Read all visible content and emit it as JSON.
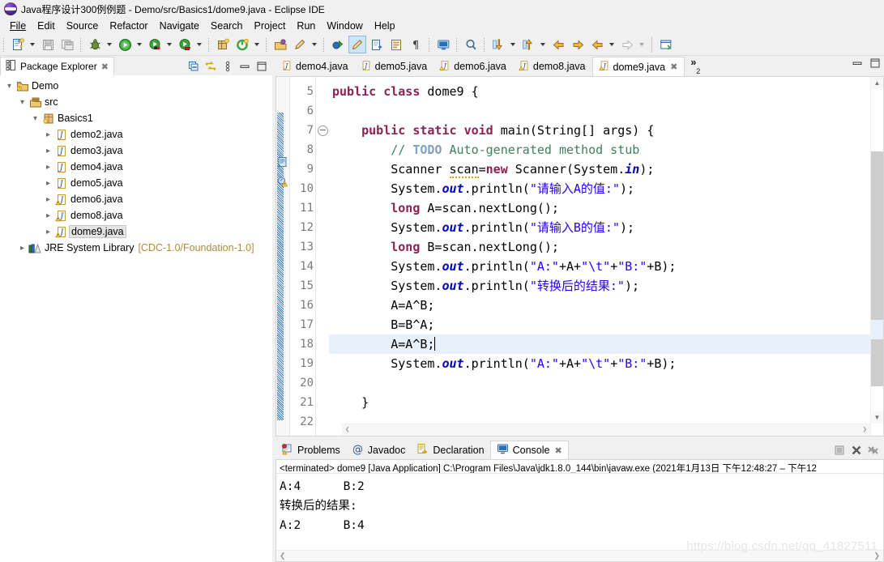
{
  "window": {
    "title": "Java程序设计300例例题 - Demo/src/Basics1/dome9.java - Eclipse IDE",
    "app_icon": "eclipse-icon"
  },
  "menubar": {
    "items": [
      {
        "label": "File"
      },
      {
        "label": "Edit"
      },
      {
        "label": "Source"
      },
      {
        "label": "Refactor"
      },
      {
        "label": "Navigate"
      },
      {
        "label": "Search"
      },
      {
        "label": "Project"
      },
      {
        "label": "Run"
      },
      {
        "label": "Window"
      },
      {
        "label": "Help"
      }
    ]
  },
  "toolbar": {
    "buttons": [
      {
        "name": "new-wizard",
        "icon": "new-file-icon"
      },
      {
        "name": "save",
        "icon": "save-icon"
      },
      {
        "name": "save-all",
        "icon": "save-all-icon"
      },
      {
        "name": "debug",
        "icon": "debug-bug-icon"
      },
      {
        "name": "run",
        "icon": "run-play-icon"
      },
      {
        "name": "coverage",
        "icon": "coverage-icon"
      },
      {
        "name": "run-external",
        "icon": "external-tools-icon"
      },
      {
        "name": "new-java-project",
        "icon": "new-java-project-icon"
      },
      {
        "name": "new-java-class",
        "icon": "new-class-icon"
      },
      {
        "name": "open-type",
        "icon": "open-type-icon"
      },
      {
        "name": "open-task",
        "icon": "task-icon"
      },
      {
        "name": "skip-breakpoints",
        "icon": "skip-breakpoints-icon"
      },
      {
        "name": "toggle-mark-occurrences",
        "icon": "mark-occurrences-icon"
      },
      {
        "name": "link-with-editor",
        "icon": "link-editor-icon"
      },
      {
        "name": "toggle-block-selection",
        "icon": "block-selection-icon"
      },
      {
        "name": "show-whitespace",
        "icon": "pilcrow-icon"
      },
      {
        "name": "toggle-console",
        "icon": "console-icon"
      },
      {
        "name": "search",
        "icon": "search-icon"
      },
      {
        "name": "next-annotation",
        "icon": "next-annotation-icon"
      },
      {
        "name": "previous-annotation",
        "icon": "previous-annotation-icon"
      },
      {
        "name": "back-history",
        "icon": "back-arrow-icon"
      },
      {
        "name": "forward-history",
        "icon": "forward-arrow-icon"
      },
      {
        "name": "previous-edit",
        "icon": "prev-edit-icon"
      },
      {
        "name": "next-edit",
        "icon": "next-edit-icon"
      },
      {
        "name": "new-window",
        "icon": "new-window-icon"
      }
    ]
  },
  "package_explorer": {
    "tab_label": "Package Explorer",
    "tab_icon": "package-explorer-icon",
    "toolbar": [
      {
        "name": "collapse-all",
        "icon": "collapse-all-icon"
      },
      {
        "name": "link-with-editor",
        "icon": "link-with-editor-icon"
      },
      {
        "name": "view-menu",
        "icon": "view-menu-icon"
      },
      {
        "name": "minimize-view",
        "icon": "minimize-icon"
      },
      {
        "name": "maximize-view",
        "icon": "maximize-icon"
      }
    ],
    "tree": [
      {
        "label": "Demo",
        "icon": "java-project-icon",
        "indent": 0,
        "twisty": "down",
        "selected": false,
        "sub": ""
      },
      {
        "label": "src",
        "icon": "source-folder-icon",
        "indent": 1,
        "twisty": "down",
        "selected": false,
        "sub": ""
      },
      {
        "label": "Basics1",
        "icon": "package-icon",
        "indent": 2,
        "twisty": "down",
        "selected": false,
        "sub": ""
      },
      {
        "label": "demo2.java",
        "icon": "java-file-icon",
        "indent": 3,
        "twisty": "right",
        "selected": false,
        "sub": ""
      },
      {
        "label": "demo3.java",
        "icon": "java-file-icon",
        "indent": 3,
        "twisty": "right",
        "selected": false,
        "sub": ""
      },
      {
        "label": "demo4.java",
        "icon": "java-file-icon",
        "indent": 3,
        "twisty": "right",
        "selected": false,
        "sub": ""
      },
      {
        "label": "demo5.java",
        "icon": "java-file-icon",
        "indent": 3,
        "twisty": "right",
        "selected": false,
        "sub": ""
      },
      {
        "label": "demo6.java",
        "icon": "java-file-warning-icon",
        "indent": 3,
        "twisty": "right",
        "selected": false,
        "sub": ""
      },
      {
        "label": "demo8.java",
        "icon": "java-file-warning-icon",
        "indent": 3,
        "twisty": "right",
        "selected": false,
        "sub": ""
      },
      {
        "label": "dome9.java",
        "icon": "java-file-warning-icon",
        "indent": 3,
        "twisty": "right",
        "selected": true,
        "sub": ""
      },
      {
        "label": "JRE System Library",
        "icon": "library-icon",
        "indent": 1,
        "twisty": "right",
        "selected": false,
        "sub": "[CDC-1.0/Foundation-1.0]"
      }
    ]
  },
  "editor": {
    "tabs": [
      {
        "label": "demo4.java",
        "icon": "java-file-icon",
        "active": false,
        "closable": false
      },
      {
        "label": "demo5.java",
        "icon": "java-file-icon",
        "active": false,
        "closable": false
      },
      {
        "label": "demo6.java",
        "icon": "java-file-warning-icon",
        "active": false,
        "closable": false
      },
      {
        "label": "demo8.java",
        "icon": "java-file-warning-icon",
        "active": false,
        "closable": false
      },
      {
        "label": "dome9.java",
        "icon": "java-file-warning-icon",
        "active": true,
        "closable": true
      }
    ],
    "overflow_chevron": "»",
    "overflow_count": "2",
    "toolbar": [
      {
        "name": "minimize-editor",
        "icon": "minimize-icon"
      },
      {
        "name": "maximize-editor",
        "icon": "maximize-icon"
      }
    ],
    "first_line_number": 5,
    "current_line": 18,
    "folded_line": 7,
    "annotations": [
      {
        "line": 8,
        "icon": "todo-task-icon"
      },
      {
        "line": 9,
        "icon": "warning-quickfix-icon"
      }
    ],
    "lines": [
      {
        "n": 5,
        "tokens": [
          {
            "t": "public",
            "c": "k"
          },
          {
            "t": " ",
            "c": "pl"
          },
          {
            "t": "class",
            "c": "k"
          },
          {
            "t": " dome9 {",
            "c": "pl"
          }
        ]
      },
      {
        "n": 6,
        "tokens": []
      },
      {
        "n": 7,
        "tokens": [
          {
            "t": "    ",
            "c": "pl"
          },
          {
            "t": "public",
            "c": "k"
          },
          {
            "t": " ",
            "c": "pl"
          },
          {
            "t": "static",
            "c": "k"
          },
          {
            "t": " ",
            "c": "pl"
          },
          {
            "t": "void",
            "c": "k"
          },
          {
            "t": " main(String[] args) {",
            "c": "pl"
          }
        ]
      },
      {
        "n": 8,
        "tokens": [
          {
            "t": "        ",
            "c": "pl"
          },
          {
            "t": "// ",
            "c": "cm"
          },
          {
            "t": "TODO",
            "c": "td"
          },
          {
            "t": " Auto-generated method stub",
            "c": "cm"
          }
        ]
      },
      {
        "n": 9,
        "tokens": [
          {
            "t": "        Scanner ",
            "c": "pl"
          },
          {
            "t": "scan",
            "c": "warn"
          },
          {
            "t": "=",
            "c": "pl"
          },
          {
            "t": "new",
            "c": "k"
          },
          {
            "t": " Scanner(System.",
            "c": "pl"
          },
          {
            "t": "in",
            "c": "fld"
          },
          {
            "t": ");",
            "c": "pl"
          }
        ]
      },
      {
        "n": 10,
        "tokens": [
          {
            "t": "        System.",
            "c": "pl"
          },
          {
            "t": "out",
            "c": "fld"
          },
          {
            "t": ".println(",
            "c": "pl"
          },
          {
            "t": "\"请输入A的值:\"",
            "c": "s"
          },
          {
            "t": ");",
            "c": "pl"
          }
        ]
      },
      {
        "n": 11,
        "tokens": [
          {
            "t": "        ",
            "c": "pl"
          },
          {
            "t": "long",
            "c": "k"
          },
          {
            "t": " A=scan.nextLong();",
            "c": "pl"
          }
        ]
      },
      {
        "n": 12,
        "tokens": [
          {
            "t": "        System.",
            "c": "pl"
          },
          {
            "t": "out",
            "c": "fld"
          },
          {
            "t": ".println(",
            "c": "pl"
          },
          {
            "t": "\"请输入B的值:\"",
            "c": "s"
          },
          {
            "t": ");",
            "c": "pl"
          }
        ]
      },
      {
        "n": 13,
        "tokens": [
          {
            "t": "        ",
            "c": "pl"
          },
          {
            "t": "long",
            "c": "k"
          },
          {
            "t": " B=scan.nextLong();",
            "c": "pl"
          }
        ]
      },
      {
        "n": 14,
        "tokens": [
          {
            "t": "        System.",
            "c": "pl"
          },
          {
            "t": "out",
            "c": "fld"
          },
          {
            "t": ".println(",
            "c": "pl"
          },
          {
            "t": "\"A:\"",
            "c": "s"
          },
          {
            "t": "+A+",
            "c": "pl"
          },
          {
            "t": "\"\\t\"",
            "c": "s"
          },
          {
            "t": "+",
            "c": "pl"
          },
          {
            "t": "\"B:\"",
            "c": "s"
          },
          {
            "t": "+B);",
            "c": "pl"
          }
        ]
      },
      {
        "n": 15,
        "tokens": [
          {
            "t": "        System.",
            "c": "pl"
          },
          {
            "t": "out",
            "c": "fld"
          },
          {
            "t": ".println(",
            "c": "pl"
          },
          {
            "t": "\"转换后的结果:\"",
            "c": "s"
          },
          {
            "t": ");",
            "c": "pl"
          }
        ]
      },
      {
        "n": 16,
        "tokens": [
          {
            "t": "        A=A^B;",
            "c": "pl"
          }
        ]
      },
      {
        "n": 17,
        "tokens": [
          {
            "t": "        B=B^A;",
            "c": "pl"
          }
        ]
      },
      {
        "n": 18,
        "tokens": [
          {
            "t": "        A=A^B;",
            "c": "pl"
          }
        ]
      },
      {
        "n": 19,
        "tokens": [
          {
            "t": "        System.",
            "c": "pl"
          },
          {
            "t": "out",
            "c": "fld"
          },
          {
            "t": ".println(",
            "c": "pl"
          },
          {
            "t": "\"A:\"",
            "c": "s"
          },
          {
            "t": "+A+",
            "c": "pl"
          },
          {
            "t": "\"\\t\"",
            "c": "s"
          },
          {
            "t": "+",
            "c": "pl"
          },
          {
            "t": "\"B:\"",
            "c": "s"
          },
          {
            "t": "+B);",
            "c": "pl"
          }
        ]
      },
      {
        "n": 20,
        "tokens": []
      },
      {
        "n": 21,
        "tokens": [
          {
            "t": "    }",
            "c": "pl"
          }
        ]
      },
      {
        "n": 22,
        "tokens": []
      }
    ]
  },
  "bottom_panel": {
    "tabs": [
      {
        "label": "Problems",
        "icon": "problems-icon",
        "active": false,
        "closable": false
      },
      {
        "label": "Javadoc",
        "icon": "javadoc-at-icon",
        "active": false,
        "closable": false
      },
      {
        "label": "Declaration",
        "icon": "declaration-icon",
        "active": false,
        "closable": false
      },
      {
        "label": "Console",
        "icon": "console-monitor-icon",
        "active": true,
        "closable": true
      }
    ],
    "toolbar": [
      {
        "name": "terminate",
        "icon": "terminate-stop-icon"
      },
      {
        "name": "remove-launch",
        "icon": "remove-x-icon"
      },
      {
        "name": "remove-all-terminated",
        "icon": "remove-all-xx-icon"
      }
    ],
    "console_header": "<terminated> dome9 [Java Application] C:\\Program Files\\Java\\jdk1.8.0_144\\bin\\javaw.exe  (2021年1月13日 下午12:48:27 – 下午12",
    "console_output": [
      "A:4      B:2",
      "转换后的结果:",
      "A:2      B:4"
    ]
  },
  "watermark": {
    "text": "https://blog.csdn.net/qq_41827511"
  }
}
